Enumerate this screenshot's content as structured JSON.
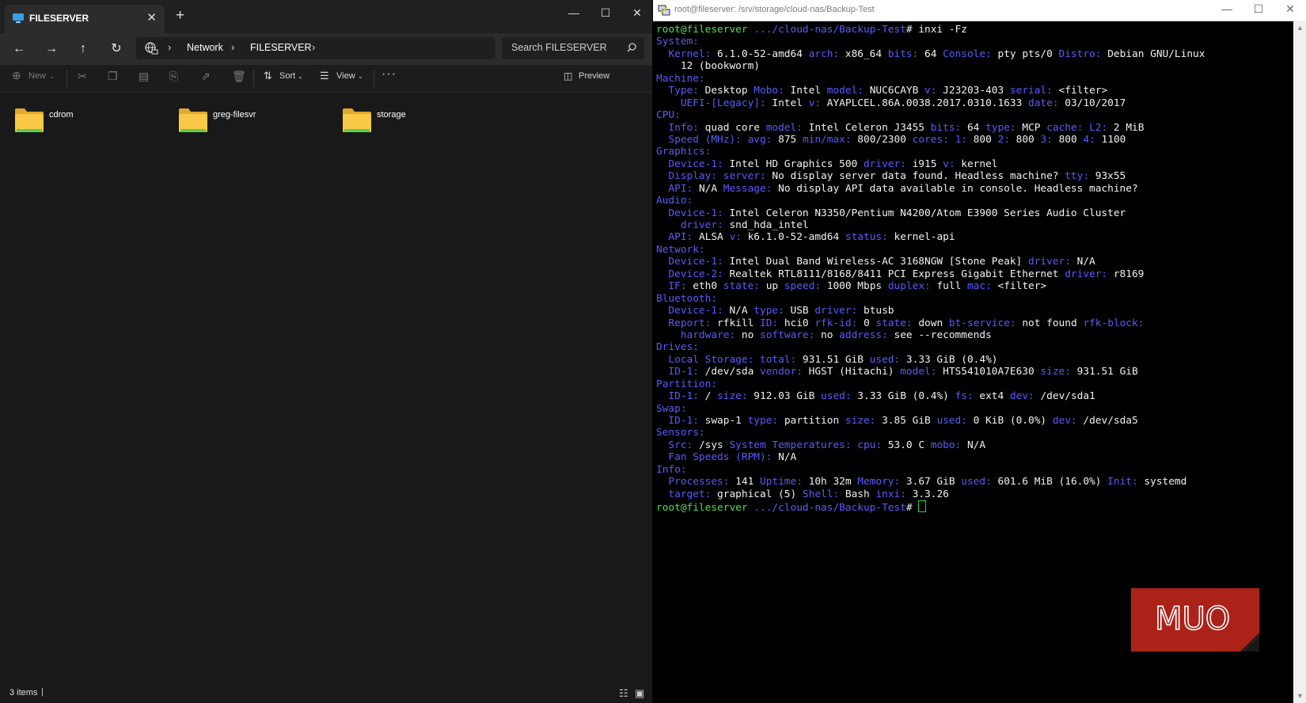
{
  "explorer": {
    "tab_title": "FILESERVER",
    "address": [
      "Network",
      "FILESERVER"
    ],
    "search_placeholder": "Search FILESERVER",
    "toolbar": {
      "new": "New",
      "sort": "Sort",
      "view": "View",
      "preview": "Preview"
    },
    "folders": [
      "cdrom",
      "greg-filesvr",
      "storage"
    ],
    "status": "3 items",
    "colors": {
      "folder": "#f9c846",
      "folder_stripe": "#5ad04f"
    }
  },
  "terminal": {
    "title": "root@fileserver: /srv/storage/cloud-nas/Backup-Test",
    "watermark": "MUO",
    "lines": [
      [
        [
          "g",
          "root@fileserver"
        ],
        [
          "b",
          " .../cloud-nas/Backup-Test"
        ],
        [
          "w",
          "# inxi -Fz"
        ]
      ],
      [
        [
          "b",
          "System:"
        ]
      ],
      [
        [
          "b",
          "  Kernel:"
        ],
        [
          "w",
          " 6.1.0-52-amd64 "
        ],
        [
          "b",
          "arch:"
        ],
        [
          "w",
          " x86_64 "
        ],
        [
          "b",
          "bits:"
        ],
        [
          "w",
          " 64 "
        ],
        [
          "b",
          "Console:"
        ],
        [
          "w",
          " pty pts/0 "
        ],
        [
          "b",
          "Distro:"
        ],
        [
          "w",
          " Debian GNU/Linux"
        ]
      ],
      [
        [
          "w",
          "    12 (bookworm)"
        ]
      ],
      [
        [
          "b",
          "Machine:"
        ]
      ],
      [
        [
          "b",
          "  Type:"
        ],
        [
          "w",
          " Desktop "
        ],
        [
          "b",
          "Mobo:"
        ],
        [
          "w",
          " Intel "
        ],
        [
          "b",
          "model:"
        ],
        [
          "w",
          " NUC6CAYB "
        ],
        [
          "b",
          "v:"
        ],
        [
          "w",
          " J23203-403 "
        ],
        [
          "b",
          "serial:"
        ],
        [
          "w",
          " <filter>"
        ]
      ],
      [
        [
          "b",
          "    UEFI-[Legacy]:"
        ],
        [
          "w",
          " Intel "
        ],
        [
          "b",
          "v:"
        ],
        [
          "w",
          " AYAPLCEL.86A.0038.2017.0310.1633 "
        ],
        [
          "b",
          "date:"
        ],
        [
          "w",
          " 03/10/2017"
        ]
      ],
      [
        [
          "b",
          "CPU:"
        ]
      ],
      [
        [
          "b",
          "  Info:"
        ],
        [
          "w",
          " quad core "
        ],
        [
          "b",
          "model:"
        ],
        [
          "w",
          " Intel Celeron J3455 "
        ],
        [
          "b",
          "bits:"
        ],
        [
          "w",
          " 64 "
        ],
        [
          "b",
          "type:"
        ],
        [
          "w",
          " MCP "
        ],
        [
          "b",
          "cache:"
        ],
        [
          "b",
          " L2:"
        ],
        [
          "w",
          " 2 MiB"
        ]
      ],
      [
        [
          "b",
          "  Speed (MHz):"
        ],
        [
          "b",
          " avg:"
        ],
        [
          "w",
          " 875 "
        ],
        [
          "b",
          "min/max:"
        ],
        [
          "w",
          " 800/2300 "
        ],
        [
          "b",
          "cores:"
        ],
        [
          "b",
          " 1:"
        ],
        [
          "w",
          " 800 "
        ],
        [
          "b",
          "2:"
        ],
        [
          "w",
          " 800 "
        ],
        [
          "b",
          "3:"
        ],
        [
          "w",
          " 800 "
        ],
        [
          "b",
          "4:"
        ],
        [
          "w",
          " 1100"
        ]
      ],
      [
        [
          "b",
          "Graphics:"
        ]
      ],
      [
        [
          "b",
          "  Device-1:"
        ],
        [
          "w",
          " Intel HD Graphics 500 "
        ],
        [
          "b",
          "driver:"
        ],
        [
          "w",
          " i915 "
        ],
        [
          "b",
          "v:"
        ],
        [
          "w",
          " kernel"
        ]
      ],
      [
        [
          "b",
          "  Display:"
        ],
        [
          "b",
          " server:"
        ],
        [
          "w",
          " No display server data found. Headless machine? "
        ],
        [
          "b",
          "tty:"
        ],
        [
          "w",
          " 93x55"
        ]
      ],
      [
        [
          "b",
          "  API:"
        ],
        [
          "w",
          " N/A "
        ],
        [
          "b",
          "Message:"
        ],
        [
          "w",
          " No display API data available in console. Headless machine?"
        ]
      ],
      [
        [
          "b",
          "Audio:"
        ]
      ],
      [
        [
          "b",
          "  Device-1:"
        ],
        [
          "w",
          " Intel Celeron N3350/Pentium N4200/Atom E3900 Series Audio Cluster"
        ]
      ],
      [
        [
          "b",
          "    driver:"
        ],
        [
          "w",
          " snd_hda_intel"
        ]
      ],
      [
        [
          "b",
          "  API:"
        ],
        [
          "w",
          " ALSA "
        ],
        [
          "b",
          "v:"
        ],
        [
          "w",
          " k6.1.0-52-amd64 "
        ],
        [
          "b",
          "status:"
        ],
        [
          "w",
          " kernel-api"
        ]
      ],
      [
        [
          "b",
          "Network:"
        ]
      ],
      [
        [
          "b",
          "  Device-1:"
        ],
        [
          "w",
          " Intel Dual Band Wireless-AC 3168NGW [Stone Peak] "
        ],
        [
          "b",
          "driver:"
        ],
        [
          "w",
          " N/A"
        ]
      ],
      [
        [
          "b",
          "  Device-2:"
        ],
        [
          "w",
          " Realtek RTL8111/8168/8411 PCI Express Gigabit Ethernet "
        ],
        [
          "b",
          "driver:"
        ],
        [
          "w",
          " r8169"
        ]
      ],
      [
        [
          "b",
          "  IF:"
        ],
        [
          "w",
          " eth0 "
        ],
        [
          "b",
          "state:"
        ],
        [
          "w",
          " up "
        ],
        [
          "b",
          "speed:"
        ],
        [
          "w",
          " 1000 Mbps "
        ],
        [
          "b",
          "duplex:"
        ],
        [
          "w",
          " full "
        ],
        [
          "b",
          "mac:"
        ],
        [
          "w",
          " <filter>"
        ]
      ],
      [
        [
          "b",
          "Bluetooth:"
        ]
      ],
      [
        [
          "b",
          "  Device-1:"
        ],
        [
          "w",
          " N/A "
        ],
        [
          "b",
          "type:"
        ],
        [
          "w",
          " USB "
        ],
        [
          "b",
          "driver:"
        ],
        [
          "w",
          " btusb"
        ]
      ],
      [
        [
          "b",
          "  Report:"
        ],
        [
          "w",
          " rfkill "
        ],
        [
          "b",
          "ID:"
        ],
        [
          "w",
          " hci0 "
        ],
        [
          "b",
          "rfk-id:"
        ],
        [
          "w",
          " 0 "
        ],
        [
          "b",
          "state:"
        ],
        [
          "w",
          " down "
        ],
        [
          "b",
          "bt-service:"
        ],
        [
          "w",
          " not found "
        ],
        [
          "b",
          "rfk-block:"
        ]
      ],
      [
        [
          "b",
          "    hardware:"
        ],
        [
          "w",
          " no "
        ],
        [
          "b",
          "software:"
        ],
        [
          "w",
          " no "
        ],
        [
          "b",
          "address:"
        ],
        [
          "w",
          " see --recommends"
        ]
      ],
      [
        [
          "b",
          "Drives:"
        ]
      ],
      [
        [
          "b",
          "  Local Storage:"
        ],
        [
          "b",
          " total:"
        ],
        [
          "w",
          " 931.51 GiB "
        ],
        [
          "b",
          "used:"
        ],
        [
          "w",
          " 3.33 GiB (0.4%)"
        ]
      ],
      [
        [
          "b",
          "  ID-1:"
        ],
        [
          "w",
          " /dev/sda "
        ],
        [
          "b",
          "vendor:"
        ],
        [
          "w",
          " HGST (Hitachi) "
        ],
        [
          "b",
          "model:"
        ],
        [
          "w",
          " HTS541010A7E630 "
        ],
        [
          "b",
          "size:"
        ],
        [
          "w",
          " 931.51 GiB"
        ]
      ],
      [
        [
          "b",
          "Partition:"
        ]
      ],
      [
        [
          "b",
          "  ID-1:"
        ],
        [
          "w",
          " / "
        ],
        [
          "b",
          "size:"
        ],
        [
          "w",
          " 912.03 GiB "
        ],
        [
          "b",
          "used:"
        ],
        [
          "w",
          " 3.33 GiB (0.4%) "
        ],
        [
          "b",
          "fs:"
        ],
        [
          "w",
          " ext4 "
        ],
        [
          "b",
          "dev:"
        ],
        [
          "w",
          " /dev/sda1"
        ]
      ],
      [
        [
          "b",
          "Swap:"
        ]
      ],
      [
        [
          "b",
          "  ID-1:"
        ],
        [
          "w",
          " swap-1 "
        ],
        [
          "b",
          "type:"
        ],
        [
          "w",
          " partition "
        ],
        [
          "b",
          "size:"
        ],
        [
          "w",
          " 3.85 GiB "
        ],
        [
          "b",
          "used:"
        ],
        [
          "w",
          " 0 KiB (0.0%) "
        ],
        [
          "b",
          "dev:"
        ],
        [
          "w",
          " /dev/sda5"
        ]
      ],
      [
        [
          "b",
          "Sensors:"
        ]
      ],
      [
        [
          "b",
          "  Src:"
        ],
        [
          "w",
          " /sys "
        ],
        [
          "b",
          "System Temperatures:"
        ],
        [
          "b",
          " cpu:"
        ],
        [
          "w",
          " 53.0 C "
        ],
        [
          "b",
          "mobo:"
        ],
        [
          "w",
          " N/A"
        ]
      ],
      [
        [
          "b",
          "  Fan Speeds (RPM):"
        ],
        [
          "w",
          " N/A"
        ]
      ],
      [
        [
          "b",
          "Info:"
        ]
      ],
      [
        [
          "b",
          "  Processes:"
        ],
        [
          "w",
          " 141 "
        ],
        [
          "b",
          "Uptime:"
        ],
        [
          "w",
          " 10h 32m "
        ],
        [
          "b",
          "Memory:"
        ],
        [
          "w",
          " 3.67 GiB "
        ],
        [
          "b",
          "used:"
        ],
        [
          "w",
          " 601.6 MiB (16.0%) "
        ],
        [
          "b",
          "Init:"
        ],
        [
          "w",
          " systemd"
        ]
      ],
      [
        [
          "b",
          "  target:"
        ],
        [
          "w",
          " graphical (5) "
        ],
        [
          "b",
          "Shell:"
        ],
        [
          "w",
          " Bash "
        ],
        [
          "b",
          "inxi:"
        ],
        [
          "w",
          " 3.3.26"
        ]
      ],
      [
        [
          "g",
          "root@fileserver"
        ],
        [
          "b",
          " .../cloud-nas/Backup-Test"
        ],
        [
          "w",
          "# "
        ]
      ]
    ]
  }
}
